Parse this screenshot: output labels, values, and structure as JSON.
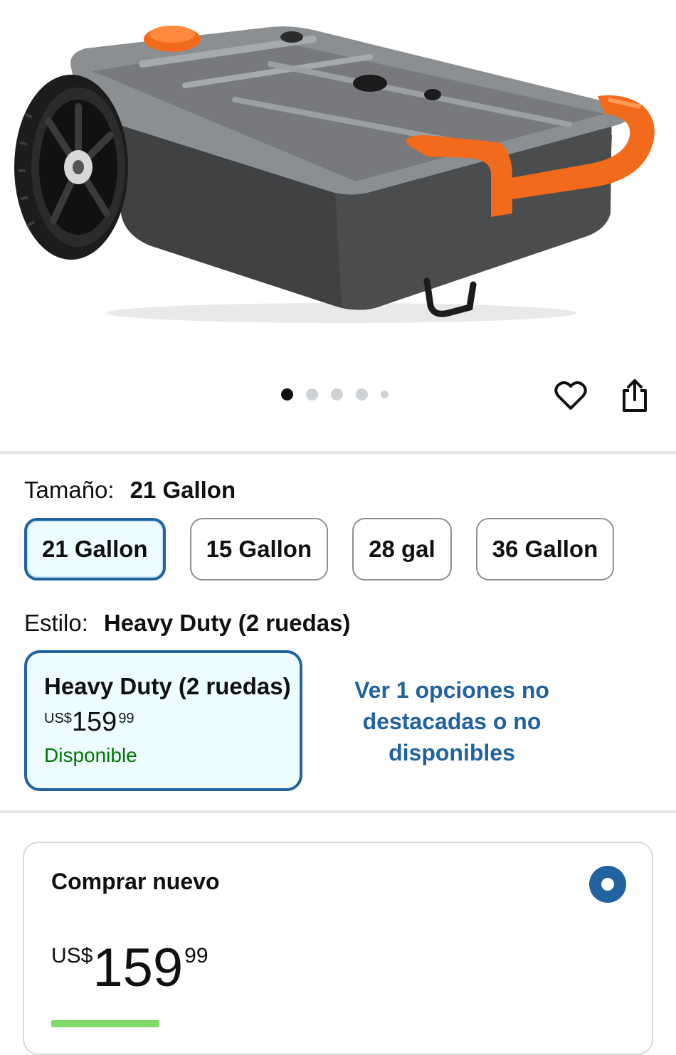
{
  "image_carousel": {
    "dots": [
      "active",
      "inactive",
      "inactive",
      "inactive",
      "small"
    ]
  },
  "actions": {
    "favorite_icon": "heart-icon",
    "share_icon": "share-icon"
  },
  "size": {
    "label": "Tamaño:",
    "selected_value": "21 Gallon",
    "options": [
      "21 Gallon",
      "15 Gallon",
      "28 gal",
      "36 Gallon"
    ]
  },
  "style": {
    "label": "Estilo:",
    "selected_value": "Heavy Duty (2 ruedas)",
    "card": {
      "title": "Heavy Duty (2 ruedas)",
      "currency": "US$",
      "price_whole": "159",
      "price_fraction": "99",
      "availability": "Disponible"
    },
    "more_options_link": "Ver 1 opciones no destacadas o no disponibles"
  },
  "buy_new": {
    "title": "Comprar nuevo",
    "currency": "US$",
    "price_whole": "159",
    "price_fraction": "99"
  },
  "colors": {
    "accent": "#2162a1",
    "selected_bg": "#edfdff",
    "available": "#007600",
    "tank_body": "#5f6265",
    "tank_accent": "#f26a1b"
  }
}
